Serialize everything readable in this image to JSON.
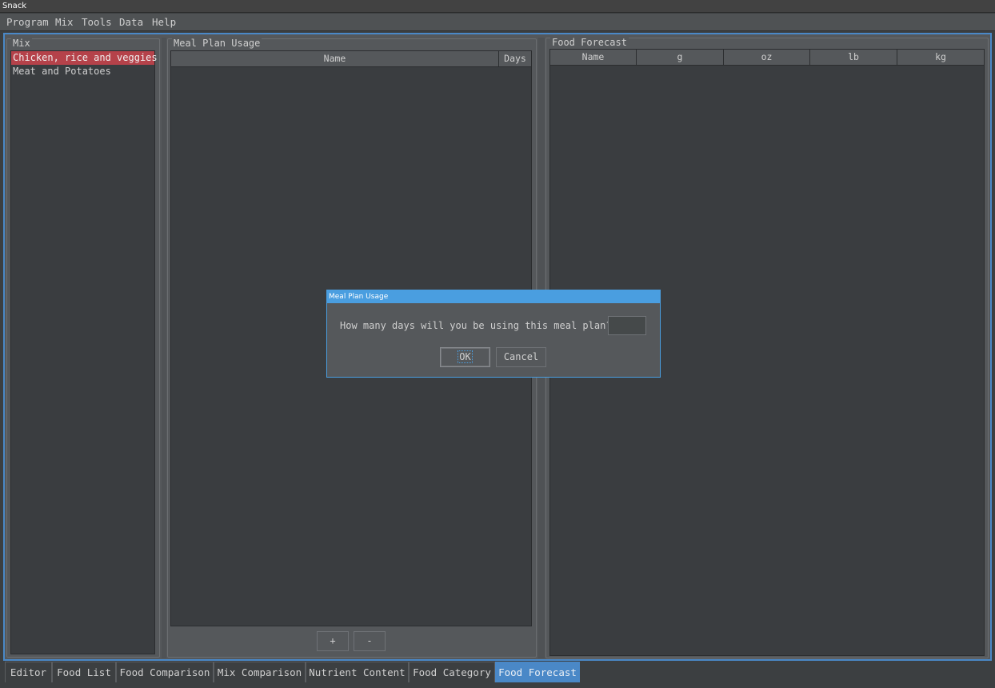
{
  "window": {
    "title": "Snack"
  },
  "menubar": {
    "items": [
      "Program",
      "Mix",
      "Tools",
      "Data",
      "Help"
    ]
  },
  "mix_panel": {
    "title": "Mix",
    "items": [
      "Chicken, rice and veggies",
      "Meat and Potatoes"
    ],
    "selected_index": 0
  },
  "meal_plan_panel": {
    "title": "Meal Plan Usage",
    "columns": [
      "Name",
      "Days"
    ],
    "add_label": "+",
    "remove_label": "-"
  },
  "forecast_panel": {
    "title": "Food Forecast",
    "columns": [
      "Name",
      "g",
      "oz",
      "lb",
      "kg"
    ]
  },
  "dialog": {
    "title": "Meal Plan Usage",
    "prompt": "How many days will you be using this meal plan?",
    "input_value": "",
    "ok_label": "OK",
    "cancel_label": "Cancel"
  },
  "tabs": {
    "items": [
      "Editor",
      "Food List",
      "Food Comparison",
      "Mix Comparison",
      "Nutrient Content",
      "Food Category",
      "Food Forecast"
    ],
    "active_index": 6
  },
  "colors": {
    "accent": "#4a88c7",
    "selection": "#b5424a",
    "background": "#3c3f41",
    "panel": "#55585b"
  }
}
